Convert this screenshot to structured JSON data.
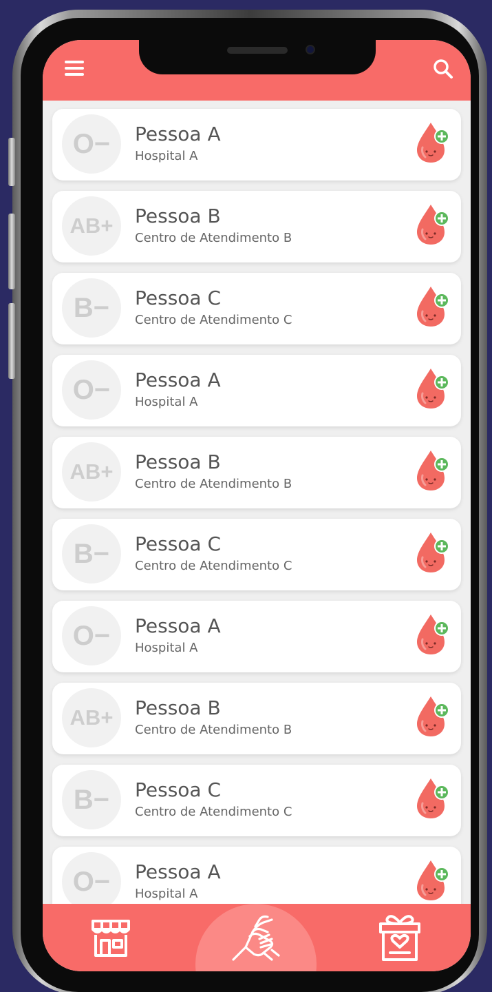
{
  "header": {
    "title": ""
  },
  "colors": {
    "accent": "#f86b68",
    "badge_text": "#cdcdcd",
    "drop": "#f26a62",
    "plus": "#5cb85c"
  },
  "items": [
    {
      "type": "O−",
      "name": "Pessoa A",
      "place": "Hospital A"
    },
    {
      "type": "AB+",
      "name": "Pessoa B",
      "place": "Centro de Atendimento B"
    },
    {
      "type": "B−",
      "name": "Pessoa C",
      "place": "Centro de Atendimento C"
    },
    {
      "type": "O−",
      "name": "Pessoa A",
      "place": "Hospital A"
    },
    {
      "type": "AB+",
      "name": "Pessoa B",
      "place": "Centro de Atendimento B"
    },
    {
      "type": "B−",
      "name": "Pessoa C",
      "place": "Centro de Atendimento C"
    },
    {
      "type": "O−",
      "name": "Pessoa A",
      "place": "Hospital A"
    },
    {
      "type": "AB+",
      "name": "Pessoa B",
      "place": "Centro de Atendimento B"
    },
    {
      "type": "B−",
      "name": "Pessoa C",
      "place": "Centro de Atendimento C"
    },
    {
      "type": "O−",
      "name": "Pessoa A",
      "place": "Hospital A"
    }
  ],
  "tabs": [
    {
      "icon": "store-icon"
    },
    {
      "icon": "handshake-icon",
      "active": true
    },
    {
      "icon": "gift-icon"
    }
  ]
}
